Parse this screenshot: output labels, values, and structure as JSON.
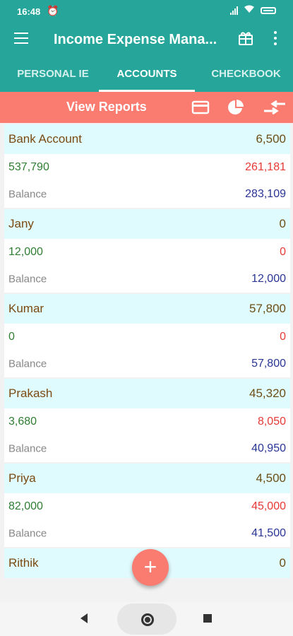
{
  "status": {
    "time": "16:48"
  },
  "app": {
    "title": "Income Expense Mana..."
  },
  "tabs": [
    {
      "label": "PERSONAL IE"
    },
    {
      "label": "ACCOUNTS"
    },
    {
      "label": "CHECKBOOK"
    }
  ],
  "reports": {
    "label": "View  Reports"
  },
  "accounts": [
    {
      "name": "Bank Account",
      "head_amount": "6,500",
      "credit": "537,790",
      "debit": "261,181",
      "balance_label": "Balance",
      "balance": "283,109"
    },
    {
      "name": "Jany",
      "head_amount": "0",
      "credit": "12,000",
      "debit": "0",
      "balance_label": "Balance",
      "balance": "12,000"
    },
    {
      "name": "Kumar",
      "head_amount": "57,800",
      "credit": "0",
      "debit": "0",
      "balance_label": "Balance",
      "balance": "57,800"
    },
    {
      "name": "Prakash",
      "head_amount": "45,320",
      "credit": "3,680",
      "debit": "8,050",
      "balance_label": "Balance",
      "balance": "40,950"
    },
    {
      "name": "Priya",
      "head_amount": "4,500",
      "credit": "82,000",
      "debit": "45,000",
      "balance_label": "Balance",
      "balance": "41,500"
    },
    {
      "name": "Rithik",
      "head_amount": "0"
    }
  ],
  "fab": {
    "symbol": "+"
  },
  "colors": {
    "primary": "#26a69a",
    "accent": "#fa7b6f",
    "row_highlight": "#e0fbfd",
    "credit": "#2e7d32",
    "debit": "#e53935",
    "balance": "#283593"
  },
  "icons": {
    "menu": "hamburger-menu-icon",
    "gift": "gift-icon",
    "more": "more-vert-icon",
    "card": "card-icon",
    "pie": "pie-chart-icon",
    "transfer": "transfer-icon"
  }
}
